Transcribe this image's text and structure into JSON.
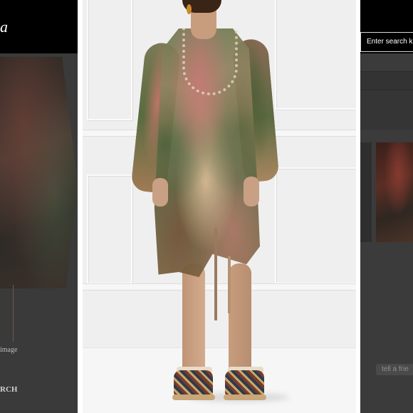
{
  "left_page": {
    "logo_fragment": "a",
    "image_caption_fragment": "image",
    "search_label_fragment": "RCH"
  },
  "right_page": {
    "search_placeholder": "Enter search ke",
    "tell_friend_label": "tell a frie"
  },
  "colors": {
    "overlay": "#3a3a3a",
    "header_black": "#000000",
    "photo_background": "#efefef"
  }
}
